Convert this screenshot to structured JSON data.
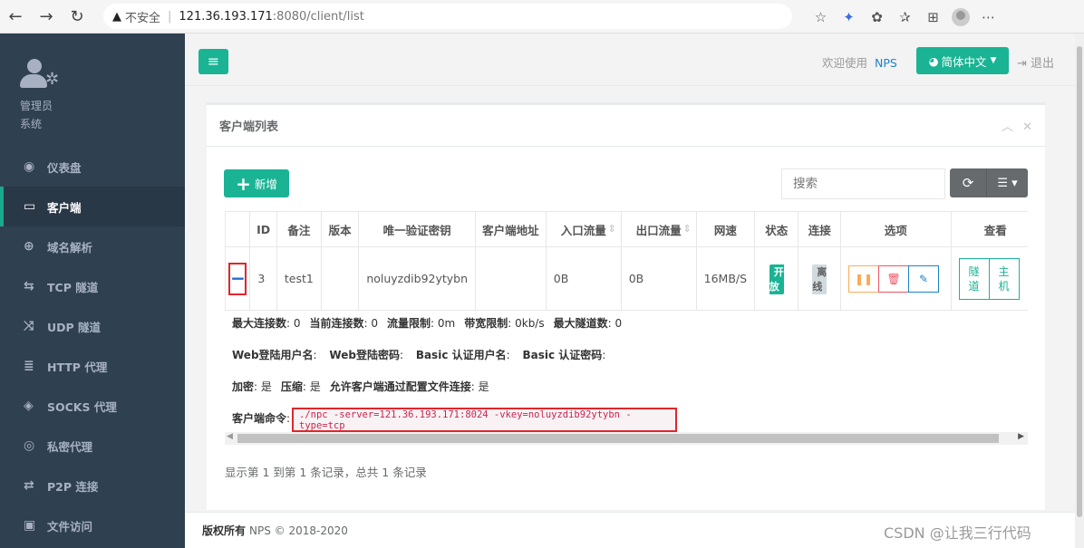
{
  "browser": {
    "back": "←",
    "forward": "→",
    "reload": "↻",
    "security_label": "不安全",
    "url_host": "121.36.193.171",
    "url_rest": ":8080/client/list"
  },
  "sidebar": {
    "user_role": "管理员",
    "user_sub": "系统",
    "items": [
      {
        "label": "仪表盘",
        "icon": "dashboard-icon",
        "glyph": "◉"
      },
      {
        "label": "客户端",
        "icon": "monitor-icon",
        "glyph": "▭",
        "active": true
      },
      {
        "label": "域名解析",
        "icon": "globe-icon",
        "glyph": "⊕"
      },
      {
        "label": "TCP 隧道",
        "icon": "exchange-icon",
        "glyph": "⇆"
      },
      {
        "label": "UDP 隧道",
        "icon": "shuffle-icon",
        "glyph": "⤨"
      },
      {
        "label": "HTTP 代理",
        "icon": "server-icon",
        "glyph": "≣"
      },
      {
        "label": "SOCKS 代理",
        "icon": "layers-icon",
        "glyph": "◈"
      },
      {
        "label": "私密代理",
        "icon": "eye-slash-icon",
        "glyph": "◎"
      },
      {
        "label": "P2P 连接",
        "icon": "arrows-icon",
        "glyph": "⇄"
      },
      {
        "label": "文件访问",
        "icon": "briefcase-icon",
        "glyph": "▣"
      }
    ]
  },
  "topbar": {
    "menu_glyph": "≡",
    "welcome": "欢迎使用",
    "brand": "NPS",
    "language": "简体中文",
    "logout": "退出"
  },
  "panel": {
    "title": "客户端列表",
    "add_label": "新增",
    "search_placeholder": "搜索"
  },
  "table": {
    "columns": [
      "",
      "ID",
      "备注",
      "版本",
      "唯一验证密钥",
      "客户端地址",
      "入口流量",
      "出口流量",
      "网速",
      "状态",
      "连接",
      "选项",
      "查看"
    ],
    "rows": [
      {
        "id": "3",
        "remark": "test1",
        "version": "",
        "vkey": "noluyzdib92ytybn",
        "address": "",
        "in_flow": "0B",
        "out_flow": "0B",
        "speed": "16MB/S",
        "status": "开放",
        "connection": "离线",
        "view_tunnel": "隧道",
        "view_host": "主机"
      }
    ]
  },
  "detail": {
    "line1": [
      {
        "k": "最大连接数",
        "v": "0"
      },
      {
        "k": "当前连接数",
        "v": "0"
      },
      {
        "k": "流量限制",
        "v": "0m"
      },
      {
        "k": "带宽限制",
        "v": "0kb/s"
      },
      {
        "k": "最大隧道数",
        "v": "0"
      }
    ],
    "line2": [
      {
        "k": "Web登陆用户名",
        "v": ""
      },
      {
        "k": "Web登陆密码",
        "v": ""
      },
      {
        "k": "Basic 认证用户名",
        "v": ""
      },
      {
        "k": "Basic 认证密码",
        "v": ""
      }
    ],
    "line3": [
      {
        "k": "加密",
        "v": "是"
      },
      {
        "k": "压缩",
        "v": "是"
      },
      {
        "k": "允许客户端通过配置文件连接",
        "v": "是"
      }
    ],
    "cmd_label": "客户端命令",
    "cmd": "./npc -server=121.36.193.171:8024 -vkey=noluyzdib92ytybn -type=tcp"
  },
  "pager": {
    "info": "显示第 1 到第 1 条记录，总共 1 条记录"
  },
  "footer": {
    "copyright_label": "版权所有",
    "copyright": "NPS © 2018-2020",
    "watermark": "CSDN @让我三行代码"
  }
}
